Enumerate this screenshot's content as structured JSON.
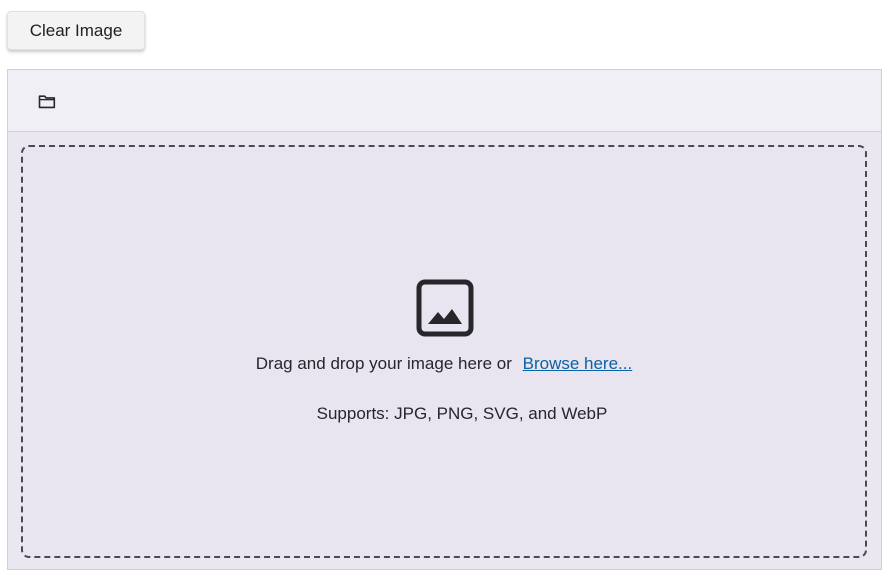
{
  "toolbar": {
    "clear_label": "Clear Image",
    "open_icon": "folder-icon"
  },
  "dropzone": {
    "icon": "image-icon",
    "prompt_text": "Drag and drop your image here or",
    "browse_label": "Browse here...",
    "supports_text": "Supports: JPG, PNG, SVG, and WebP"
  },
  "colors": {
    "link": "#0b62a4",
    "dropzone_bg": "#e8e4f0",
    "toolbar_bg": "#f0eff5"
  }
}
